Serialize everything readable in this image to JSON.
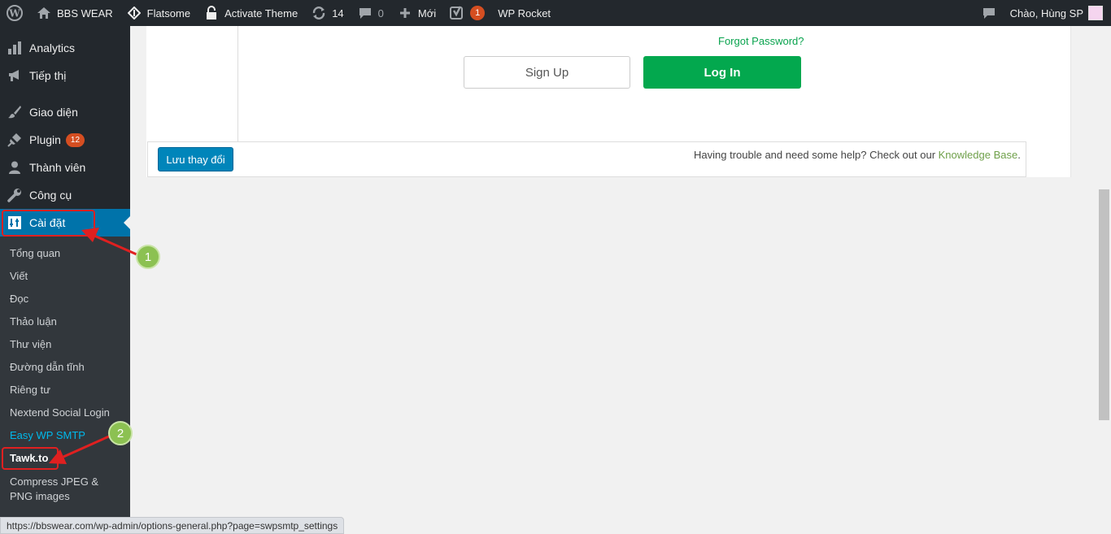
{
  "adminbar": {
    "site_name": "BBS WEAR",
    "theme_link": "Flatsome",
    "activate_theme": "Activate Theme",
    "updates_count": "14",
    "comments_count": "0",
    "new_label": "Mới",
    "yoast_badge": "1",
    "wp_rocket": "WP Rocket",
    "greeting": "Chào, Hùng SP"
  },
  "sidebar": {
    "items": [
      {
        "label": "Analytics",
        "icon": "bar-chart-icon"
      },
      {
        "label": "Tiếp thị",
        "icon": "megaphone-icon"
      },
      {
        "label": "Giao diện",
        "icon": "brush-icon"
      },
      {
        "label": "Plugin",
        "icon": "plugin-icon",
        "badge": "12"
      },
      {
        "label": "Thành viên",
        "icon": "user-icon"
      },
      {
        "label": "Công cụ",
        "icon": "wrench-icon"
      },
      {
        "label": "Cài đặt",
        "icon": "settings-icon",
        "active": true
      }
    ],
    "submenu": [
      "Tổng quan",
      "Viết",
      "Đọc",
      "Thảo luận",
      "Thư viện",
      "Đường dẫn tĩnh",
      "Riêng tư",
      "Nextend Social Login",
      "Easy WP SMTP",
      "Tawk.to",
      "Compress JPEG & PNG images"
    ]
  },
  "main": {
    "forgot_password": "Forgot Password?",
    "signup_label": "Sign Up",
    "login_label": "Log In",
    "save_label": "Lưu thay đổi",
    "help_text": "Having trouble and need some help? Check out our ",
    "help_link": "Knowledge Base",
    "help_end": "."
  },
  "annotations": {
    "step1": "1",
    "step2": "2"
  },
  "statusbar": {
    "url": "https://bbswear.com/wp-admin/options-general.php?page=swpsmtp_settings"
  },
  "colors": {
    "adminbar_bg": "#23282d",
    "active_menu": "#0073aa",
    "login_green": "#03a84e",
    "annotation_red": "#e02020",
    "annotation_green": "#8cc152"
  }
}
